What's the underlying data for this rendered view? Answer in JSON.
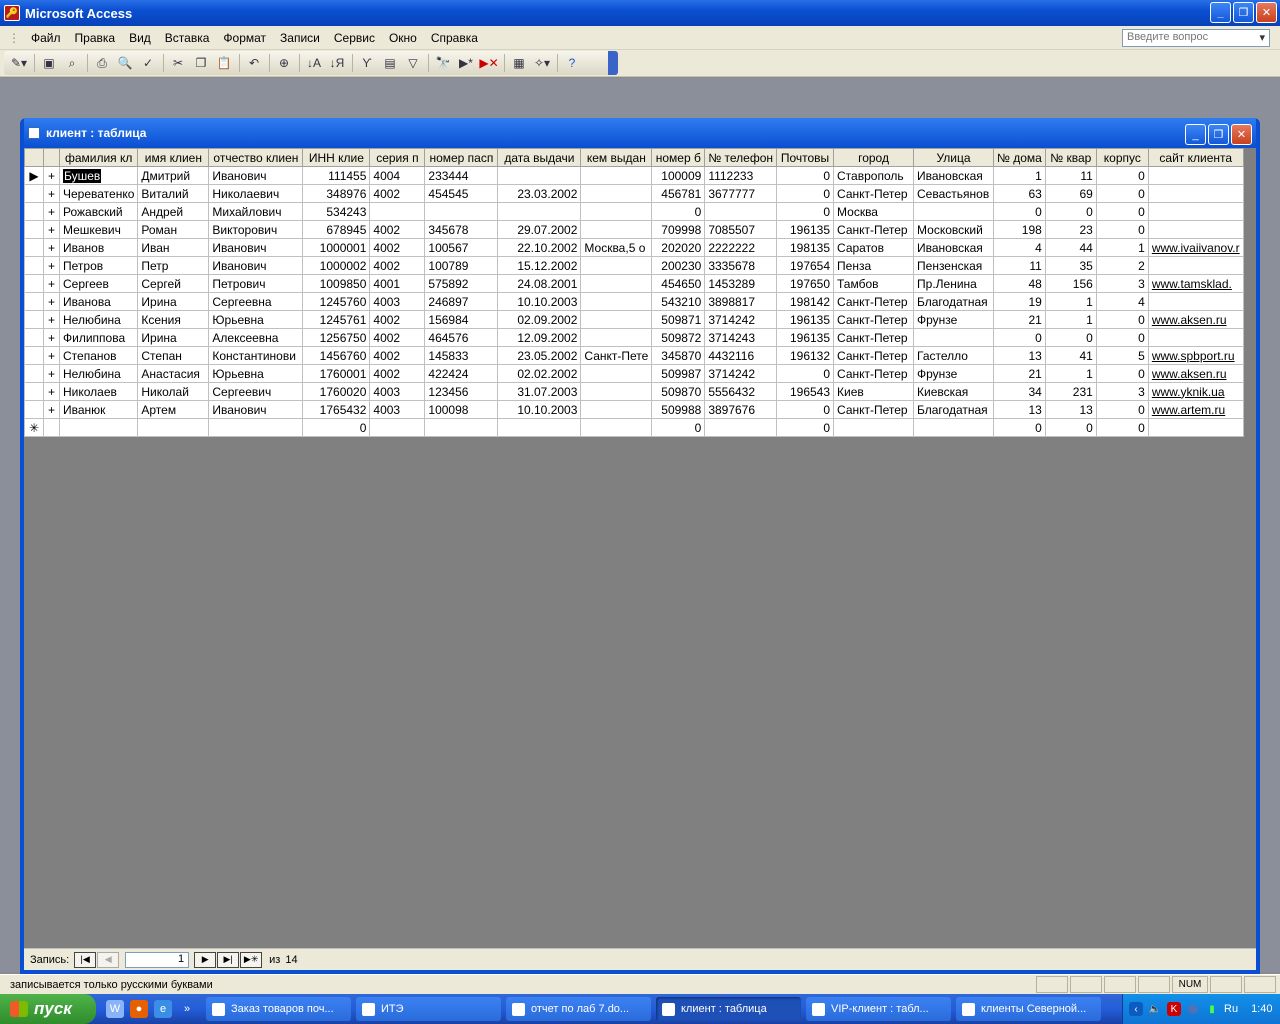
{
  "app": {
    "title": "Microsoft Access",
    "minimize": "_",
    "maximize": "❐",
    "close": "✕"
  },
  "menu": {
    "items": [
      "Файл",
      "Правка",
      "Вид",
      "Вставка",
      "Формат",
      "Записи",
      "Сервис",
      "Окно",
      "Справка"
    ],
    "ask_placeholder": "Введите вопрос"
  },
  "toolbar": {
    "buttons": [
      "view-icon",
      "save-icon",
      "search-file-icon",
      "print-icon",
      "print-preview-icon",
      "spelling-icon",
      "cut-icon",
      "copy-icon",
      "paste-icon",
      "undo-icon",
      "hyperlink-icon",
      "sort-asc-icon",
      "sort-desc-icon",
      "filter-by-selection-icon",
      "filter-by-form-icon",
      "apply-filter-icon",
      "find-icon",
      "new-record-icon",
      "delete-record-icon",
      "database-window-icon",
      "new-object-icon",
      "help-icon"
    ]
  },
  "child_window": {
    "title": "клиент : таблица"
  },
  "grid": {
    "columns": [
      "фамилия  кл",
      "имя  клиен",
      "отчество  клиен",
      "ИНН  клие",
      "серия  п",
      "номер пасп",
      "дата  выдачи",
      "кем выдан",
      "номер б",
      "№ телефон",
      "Почтовы",
      "город",
      "Улица",
      "№ дома",
      "№  квар",
      "корпус",
      "сайт клиента"
    ],
    "rows": [
      [
        "Бушев",
        "Дмитрий",
        "Иванович",
        "111455",
        "4004",
        "233444",
        "",
        "",
        "100009",
        "1112233",
        "0",
        "Ставрополь",
        "Ивановская",
        "1",
        "11",
        "0",
        ""
      ],
      [
        "Череватенко",
        "Виталий",
        "Николаевич",
        "348976",
        "4002",
        "454545",
        "23.03.2002",
        "",
        "456781",
        "3677777",
        "0",
        "Санкт-Петер",
        "Севастьянов",
        "63",
        "69",
        "0",
        ""
      ],
      [
        "Рожавский",
        "Андрей",
        "Михайлович",
        "534243",
        "",
        "",
        "",
        "",
        "0",
        "",
        "0",
        "Москва",
        "",
        "0",
        "0",
        "0",
        ""
      ],
      [
        "Мешкевич",
        "Роман",
        "Викторович",
        "678945",
        "4002",
        "345678",
        "29.07.2002",
        "",
        "709998",
        "7085507",
        "196135",
        "Санкт-Петер",
        "Московский",
        "198",
        "23",
        "0",
        ""
      ],
      [
        "Иванов",
        "Иван",
        "Иванович",
        "1000001",
        "4002",
        "100567",
        "22.10.2002",
        "Москва,5 о",
        "202020",
        "2222222",
        "198135",
        "Саратов",
        "Ивановская",
        "4",
        "44",
        "1",
        "www.ivaiivanov.r"
      ],
      [
        "Петров",
        "Петр",
        "Иванович",
        "1000002",
        "4002",
        "100789",
        "15.12.2002",
        "",
        "200230",
        "3335678",
        "197654",
        "Пенза",
        "Пензенская",
        "11",
        "35",
        "2",
        ""
      ],
      [
        "Сергеев",
        "Сергей",
        "Петрович",
        "1009850",
        "4001",
        "575892",
        "24.08.2001",
        "",
        "454650",
        "1453289",
        "197650",
        "Тамбов",
        "Пр.Ленина",
        "48",
        "156",
        "3",
        "www.tamsklad."
      ],
      [
        "Иванова",
        "Ирина",
        "Сергеевна",
        "1245760",
        "4003",
        "246897",
        "10.10.2003",
        "",
        "543210",
        "3898817",
        "198142",
        "Санкт-Петер",
        "Благодатная",
        "19",
        "1",
        "4",
        ""
      ],
      [
        "Нелюбина",
        "Ксения",
        "Юрьевна",
        "1245761",
        "4002",
        "156984",
        "02.09.2002",
        "",
        "509871",
        "3714242",
        "196135",
        "Санкт-Петер",
        "Фрунзе",
        "21",
        "1",
        "0",
        "www.aksen.ru"
      ],
      [
        "Филиппова",
        "Ирина",
        "Алексеевна",
        "1256750",
        "4002",
        "464576",
        "12.09.2002",
        "",
        "509872",
        "3714243",
        "196135",
        "Санкт-Петер",
        "",
        "0",
        "0",
        "0",
        ""
      ],
      [
        "Степанов",
        "Степан",
        "Константинови",
        "1456760",
        "4002",
        "145833",
        "23.05.2002",
        "Санкт-Пете",
        "345870",
        "4432116",
        "196132",
        "Санкт-Петер",
        "Гастелло",
        "13",
        "41",
        "5",
        "www.spbport.ru"
      ],
      [
        "Нелюбина",
        "Анастасия",
        "Юрьевна",
        "1760001",
        "4002",
        "422424",
        "02.02.2002",
        "",
        "509987",
        "3714242",
        "0",
        "Санкт-Петер",
        "Фрунзе",
        "21",
        "1",
        "0",
        "www.aksen.ru"
      ],
      [
        "Николаев",
        "Николай",
        "Сергеевич",
        "1760020",
        "4003",
        "123456",
        "31.07.2003",
        "",
        "509870",
        "5556432",
        "196543",
        "Киев",
        "Киевская",
        "34",
        "231",
        "3",
        "www.yknik.ua"
      ],
      [
        "Иванюк",
        "Артем",
        "Иванович",
        "1765432",
        "4003",
        "100098",
        "10.10.2003",
        "",
        "509988",
        "3897676",
        "0",
        "Санкт-Петер",
        "Благодатная",
        "13",
        "13",
        "0",
        "www.artem.ru"
      ]
    ],
    "new_row": [
      "",
      "",
      "",
      "0",
      "",
      "",
      "",
      "",
      "0",
      "",
      "0",
      "",
      "",
      "0",
      "0",
      "0",
      ""
    ],
    "row_selector_current": "▶",
    "row_selector_new": "✳",
    "expand_glyph": "+"
  },
  "record_nav": {
    "label": "Запись:",
    "current": "1",
    "of_label": "из",
    "total": "14",
    "first": "|◀",
    "prev": "◀",
    "next": "▶",
    "last": "▶|",
    "new": "▶✳"
  },
  "status": {
    "message": "записывается только русскими буквами",
    "num": "NUM"
  },
  "taskbar": {
    "start": "пуск",
    "items": [
      {
        "label": "Заказ товаров поч...",
        "active": false
      },
      {
        "label": "ИТЭ",
        "active": false
      },
      {
        "label": "отчет по лаб 7.do...",
        "active": false
      },
      {
        "label": "клиент : таблица",
        "active": true
      },
      {
        "label": "VIP-клиент : табл...",
        "active": false
      },
      {
        "label": "клиенты Северной...",
        "active": false
      }
    ],
    "lang": "Ru",
    "clock": "1:40"
  },
  "colors": {
    "title_blue": "#0a4fd1",
    "grid_bg": "#808080",
    "link": "#0000ee",
    "start_green": "#2f8d2b"
  }
}
